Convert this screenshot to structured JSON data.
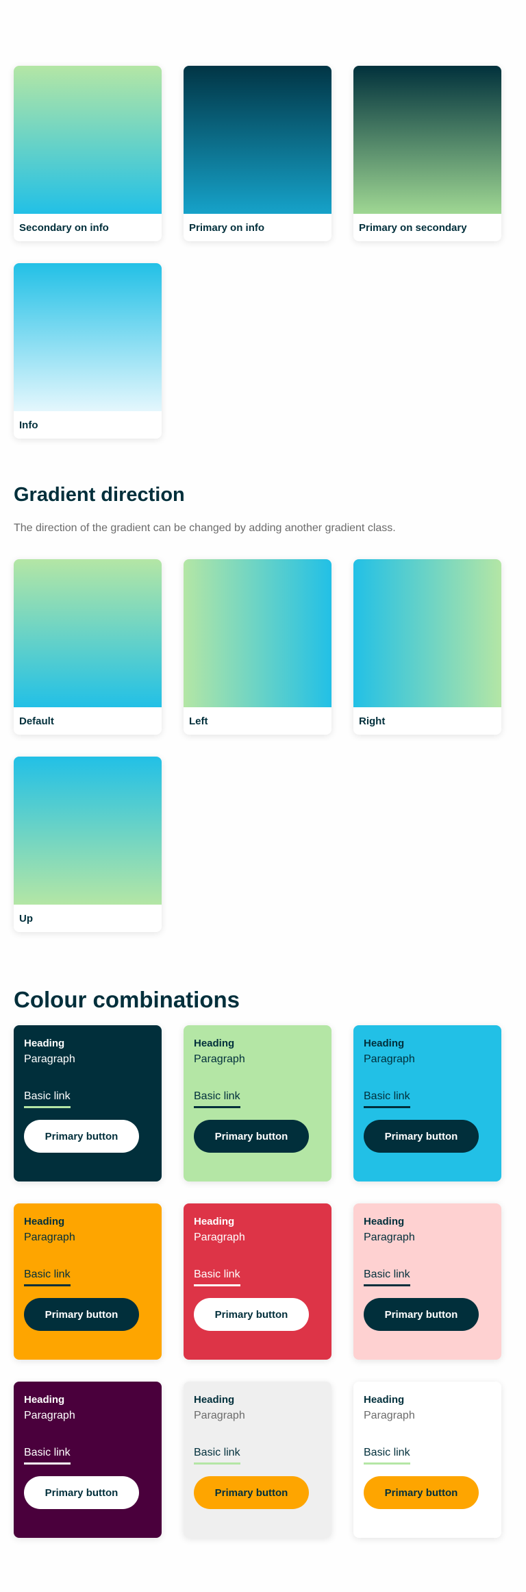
{
  "gradients_top": [
    {
      "label": "Secondary on info",
      "gradient": "secondary-to-info"
    },
    {
      "label": "Primary on info",
      "gradient": "primary-to-info"
    },
    {
      "label": "Primary on secondary",
      "gradient": "primary-to-secondary"
    },
    {
      "label": "Info",
      "gradient": "info-to-white"
    }
  ],
  "gradient_direction": {
    "title": "Gradient direction",
    "description": "The direction of the gradient can be changed by adding another gradient class.",
    "swatches": [
      {
        "label": "Default",
        "direction": "down"
      },
      {
        "label": "Left",
        "direction": "left"
      },
      {
        "label": "Right",
        "direction": "right"
      },
      {
        "label": "Up",
        "direction": "up"
      }
    ]
  },
  "colour_combinations": {
    "title": "Colour combinations",
    "cards": [
      {
        "heading": "Heading",
        "paragraph": "Paragraph",
        "link": "Basic link",
        "button": "Primary button",
        "background": "#012f3b"
      },
      {
        "heading": "Heading",
        "paragraph": "Paragraph",
        "link": "Basic link",
        "button": "Primary button",
        "background": "#b4e6a5"
      },
      {
        "heading": "Heading",
        "paragraph": "Paragraph",
        "link": "Basic link",
        "button": "Primary button",
        "background": "#22c0e6"
      },
      {
        "heading": "Heading",
        "paragraph": "Paragraph",
        "link": "Basic link",
        "button": "Primary button",
        "background": "#fea500"
      },
      {
        "heading": "Heading",
        "paragraph": "Paragraph",
        "link": "Basic link",
        "button": "Primary button",
        "background": "#dd3447"
      },
      {
        "heading": "Heading",
        "paragraph": "Paragraph",
        "link": "Basic link",
        "button": "Primary button",
        "background": "#fed1d1"
      },
      {
        "heading": "Heading",
        "paragraph": "Paragraph",
        "link": "Basic link",
        "button": "Primary button",
        "background": "#4a003c"
      },
      {
        "heading": "Heading",
        "paragraph": "Paragraph",
        "link": "Basic link",
        "button": "Primary button",
        "background": "#efefef"
      },
      {
        "heading": "Heading",
        "paragraph": "Paragraph",
        "link": "Basic link",
        "button": "Primary button",
        "background": "#ffffff"
      }
    ]
  },
  "colors": {
    "primary": "#012f3b",
    "secondary": "#b4e6a5",
    "info": "#22c0e6",
    "warning": "#fea500",
    "danger": "#dd3447",
    "muted_text": "#6b6b6b"
  }
}
